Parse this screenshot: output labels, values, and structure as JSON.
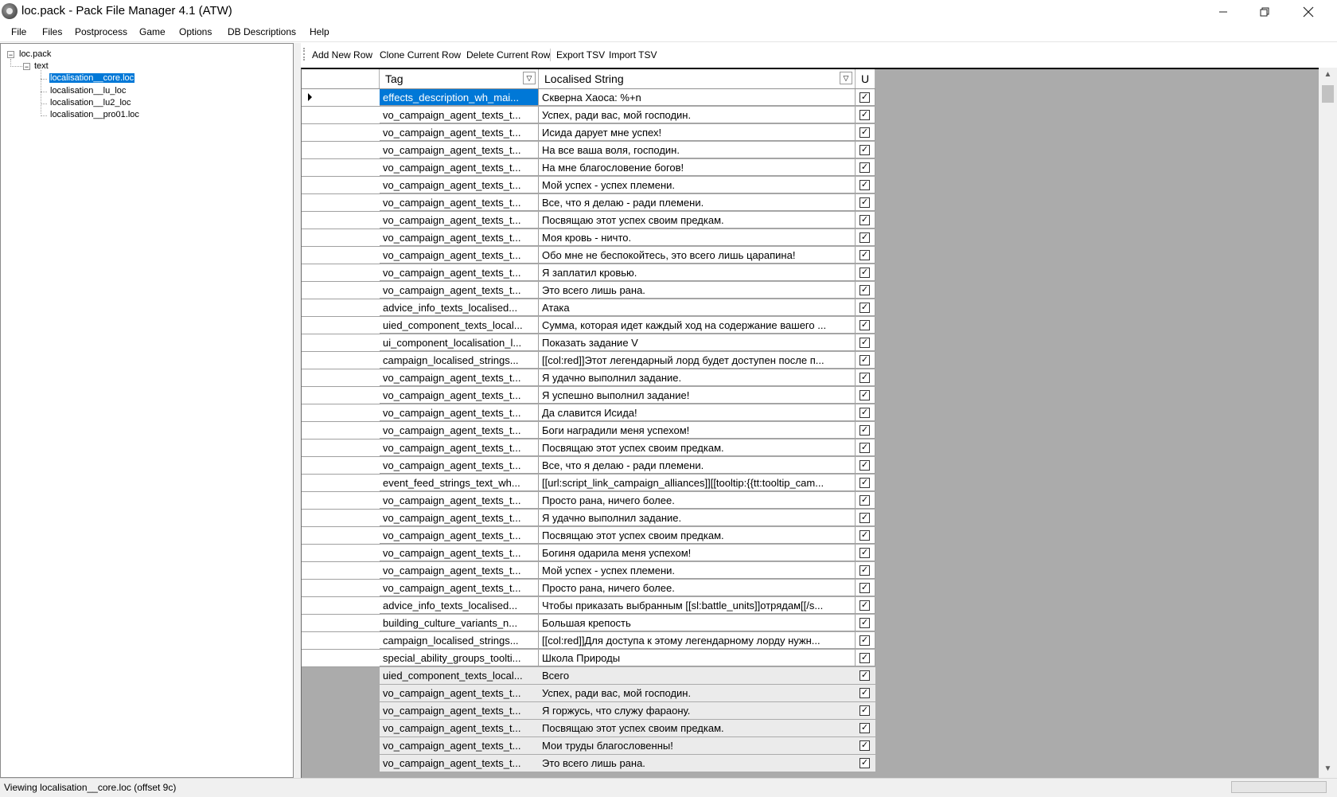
{
  "window": {
    "title": "loc.pack - Pack File Manager 4.1 (ATW)"
  },
  "menu": [
    "File",
    "Files",
    "Postprocess",
    "Game",
    "Options",
    "DB Descriptions",
    "Help"
  ],
  "tree": {
    "root": "loc.pack",
    "folder": "text",
    "files": [
      "localisation__core.loc",
      "localisation__lu_loc",
      "localisation__lu2_loc",
      "localisation__pro01.loc"
    ],
    "selected_index": 0
  },
  "toolbar": {
    "add_row": "Add New Row",
    "clone_row": "Clone Current Row",
    "delete_row": "Delete Current Row",
    "export_tsv": "Export TSV",
    "import_tsv": "Import TSV"
  },
  "grid": {
    "columns": {
      "tag": "Tag",
      "localised": "Localised String",
      "untranslated": "U"
    },
    "current_row": 0,
    "rows": [
      {
        "tag": "effects_description_wh_mai...",
        "text": "Скверна Хаоса: %+n",
        "checked": true
      },
      {
        "tag": "vo_campaign_agent_texts_t...",
        "text": "Успех, ради вас, мой господин.",
        "checked": true
      },
      {
        "tag": "vo_campaign_agent_texts_t...",
        "text": "Исида дарует мне успех!",
        "checked": true
      },
      {
        "tag": "vo_campaign_agent_texts_t...",
        "text": "На все ваша воля, господин.",
        "checked": true
      },
      {
        "tag": "vo_campaign_agent_texts_t...",
        "text": "На мне благословение богов!",
        "checked": true
      },
      {
        "tag": "vo_campaign_agent_texts_t...",
        "text": "Мой успех - успех племени.",
        "checked": true
      },
      {
        "tag": "vo_campaign_agent_texts_t...",
        "text": "Все, что я делаю - ради племени.",
        "checked": true
      },
      {
        "tag": "vo_campaign_agent_texts_t...",
        "text": "Посвящаю этот успех своим предкам.",
        "checked": true
      },
      {
        "tag": "vo_campaign_agent_texts_t...",
        "text": "Моя кровь - ничто.",
        "checked": true
      },
      {
        "tag": "vo_campaign_agent_texts_t...",
        "text": "Обо мне не беспокойтесь, это всего лишь царапина!",
        "checked": true
      },
      {
        "tag": "vo_campaign_agent_texts_t...",
        "text": "Я заплатил кровью.",
        "checked": true
      },
      {
        "tag": "vo_campaign_agent_texts_t...",
        "text": "Это всего лишь рана.",
        "checked": true
      },
      {
        "tag": "advice_info_texts_localised...",
        "text": "Атака",
        "checked": true
      },
      {
        "tag": "uied_component_texts_local...",
        "text": "Сумма, которая идет каждый ход на содержание вашего ...",
        "checked": true
      },
      {
        "tag": "ui_component_localisation_l...",
        "text": "Показать задание V",
        "checked": true
      },
      {
        "tag": "campaign_localised_strings...",
        "text": "[[col:red]]Этот легендарный лорд будет доступен после п...",
        "checked": true
      },
      {
        "tag": "vo_campaign_agent_texts_t...",
        "text": "Я удачно выполнил задание.",
        "checked": true
      },
      {
        "tag": "vo_campaign_agent_texts_t...",
        "text": "Я успешно выполнил задание!",
        "checked": true
      },
      {
        "tag": "vo_campaign_agent_texts_t...",
        "text": "Да славится Исида!",
        "checked": true
      },
      {
        "tag": "vo_campaign_agent_texts_t...",
        "text": "Боги наградили меня успехом!",
        "checked": true
      },
      {
        "tag": "vo_campaign_agent_texts_t...",
        "text": "Посвящаю этот успех своим предкам.",
        "checked": true
      },
      {
        "tag": "vo_campaign_agent_texts_t...",
        "text": "Все, что я делаю - ради племени.",
        "checked": true
      },
      {
        "tag": "event_feed_strings_text_wh...",
        "text": "[[url:script_link_campaign_alliances]][[tooltip:{{tt:tooltip_cam...",
        "checked": true
      },
      {
        "tag": "vo_campaign_agent_texts_t...",
        "text": "Просто рана, ничего более.",
        "checked": true
      },
      {
        "tag": "vo_campaign_agent_texts_t...",
        "text": "Я удачно выполнил задание.",
        "checked": true
      },
      {
        "tag": "vo_campaign_agent_texts_t...",
        "text": "Посвящаю этот успех своим предкам.",
        "checked": true
      },
      {
        "tag": "vo_campaign_agent_texts_t...",
        "text": "Богиня одарила меня успехом!",
        "checked": true
      },
      {
        "tag": "vo_campaign_agent_texts_t...",
        "text": "Мой успех - успех племени.",
        "checked": true
      },
      {
        "tag": "vo_campaign_agent_texts_t...",
        "text": "Просто рана, ничего более.",
        "checked": true
      },
      {
        "tag": "advice_info_texts_localised...",
        "text": "Чтобы приказать выбранным [[sl:battle_units]]отрядам[[/s...",
        "checked": true
      },
      {
        "tag": "building_culture_variants_n...",
        "text": "Большая крепость",
        "checked": true
      },
      {
        "tag": "campaign_localised_strings...",
        "text": "[[col:red]]Для доступа к этому легендарному лорду нужн...",
        "checked": true
      },
      {
        "tag": "special_ability_groups_toolti...",
        "text": "Школа Природы",
        "checked": true
      },
      {
        "tag": "uied_component_texts_local...",
        "text": "Всего",
        "checked": true
      },
      {
        "tag": "vo_campaign_agent_texts_t...",
        "text": "Успех, ради вас, мой господин.",
        "checked": true
      },
      {
        "tag": "vo_campaign_agent_texts_t...",
        "text": "Я горжусь, что служу фараону.",
        "checked": true
      },
      {
        "tag": "vo_campaign_agent_texts_t...",
        "text": "Посвящаю этот успех своим предкам.",
        "checked": true
      },
      {
        "tag": "vo_campaign_agent_texts_t...",
        "text": "Мои труды благословенны!",
        "checked": true
      },
      {
        "tag": "vo_campaign_agent_texts_t...",
        "text": "Это всего лишь рана.",
        "checked": true
      }
    ]
  },
  "status": {
    "text": "Viewing localisation__core.loc (offset 9c)"
  }
}
